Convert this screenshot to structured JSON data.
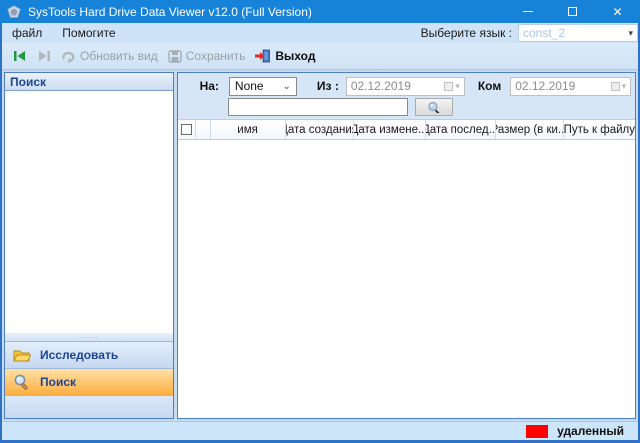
{
  "window": {
    "title": "SysTools Hard Drive Data Viewer v12.0 (Full Version)"
  },
  "menubar": {
    "file_label": "файл",
    "help_label": "Помогите",
    "language_label": "Выберите язык :",
    "language_value": "const_2"
  },
  "toolbar": {
    "refresh_label": "Обновить вид",
    "save_label": "Сохранить",
    "exit_label": "Выход"
  },
  "left_panel": {
    "header": "Поиск",
    "nav_explore_label": "Исследовать",
    "nav_search_label": "Поиск",
    "splitter_dots": "......"
  },
  "filters": {
    "on_label": "На:",
    "on_value": "None",
    "from_label": "Из :",
    "from_value": "02.12.2019",
    "to_label": "Ком",
    "to_value": "02.12.2019",
    "search_value": ""
  },
  "table": {
    "columns": [
      "",
      "",
      "имя",
      "Дата создания",
      "Дата измене...",
      "Дата послед...",
      "Размер (в ки...",
      "Путь к файлу"
    ],
    "rows": []
  },
  "statusbar": {
    "deleted_label": "удаленный",
    "deleted_color": "#ff0000"
  },
  "colors": {
    "titlebar_blue": "#1683d9",
    "selection_orange": "#fcae3f",
    "frame_blue": "#2e72c8"
  }
}
